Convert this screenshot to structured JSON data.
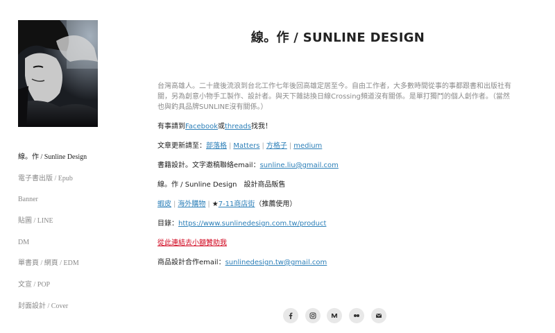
{
  "site_title": "線。作 / SUNLINE  DESIGN",
  "nav": [
    "線。作 / Sunline Design",
    "電子書出版 / Epub",
    "Banner",
    "貼圖 / LINE",
    "DM",
    "單書頁 / 網頁 / EDM",
    "文宣 / POP",
    "封面設計 / Cover"
  ],
  "intro": "台灣高雄人。二十歲後流浪到台北工作七年後回高雄定居至今。自由工作者，大多數時間從事的事都跟書和出版社有關，另為創意小物手工製作、設計者。與天下雜誌換日線Crossing頻道沒有關係。是單打獨鬥的個人創作者。（當然也與釣具品牌SUNLINE沒有關係。）",
  "contact": {
    "prefix": "有事請到",
    "facebook": "Facebook",
    "or": "或",
    "threads": "threads",
    "suffix": "找我！"
  },
  "articles": {
    "label": "文章更新請至：",
    "links": [
      "部落格",
      "Matters",
      "方格子",
      "medium"
    ]
  },
  "books": {
    "label": "書籍設計。文字邀稿聯絡email：",
    "email": "sunline.liu@gmail.com"
  },
  "shop_title": "線。作 / Sunline Design　設計商品販售",
  "shop_links": {
    "shopee": "蝦皮",
    "overseas": "海外購物",
    "star": "★",
    "seven": "7-11商店街",
    "note": "（推薦使用）"
  },
  "catalog": {
    "label": "目錄：",
    "url": "https://www.sunlinedesign.com.tw/product"
  },
  "sponsor": "從此連結去小額贊助我",
  "cooperation": {
    "label": "商品設計合作email：",
    "email": "sunlinedesign.tw@gmail.com"
  },
  "social_icons": [
    "facebook-icon",
    "instagram-icon",
    "medium-icon",
    "flickr-icon",
    "email-icon"
  ]
}
